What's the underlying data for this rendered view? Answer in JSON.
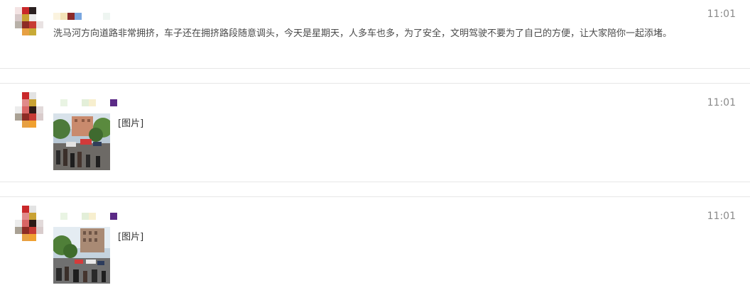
{
  "messages": [
    {
      "time": "11:01",
      "text": "洗马河方向道路非常拥挤，车子还在拥挤路段随意调头，今天是星期天，人多车也多，为了安全，文明驾驶不要为了自己的方便，让大家陪你一起添堵。"
    },
    {
      "time": "11:01",
      "image_label": "[图片]"
    },
    {
      "time": "11:01",
      "image_label": "[图片]"
    }
  ],
  "colors": {
    "divider": "#e7e7e7",
    "time": "#8a8a8a",
    "text": "#4a4a4a"
  }
}
